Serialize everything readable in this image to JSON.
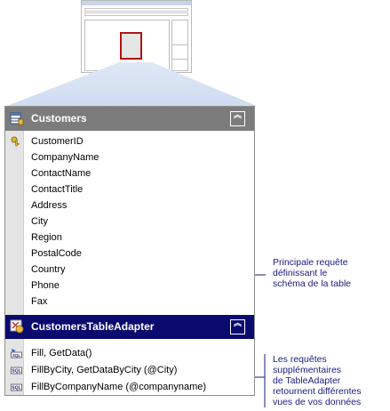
{
  "customers_table": {
    "title": "Customers",
    "columns": [
      {
        "name": "CustomerID",
        "key": true
      },
      {
        "name": "CompanyName"
      },
      {
        "name": "ContactName"
      },
      {
        "name": "ContactTitle"
      },
      {
        "name": "Address"
      },
      {
        "name": "City"
      },
      {
        "name": "Region"
      },
      {
        "name": "PostalCode"
      },
      {
        "name": "Country"
      },
      {
        "name": "Phone"
      },
      {
        "name": "Fax"
      }
    ]
  },
  "table_adapter": {
    "title": "CustomersTableAdapter",
    "queries": [
      {
        "label": "Fill, GetData()",
        "icon": "sql-main-query-icon"
      },
      {
        "label": "FillByCity, GetDataByCity (@City)",
        "icon": "sql-icon"
      },
      {
        "label": "FillByCompanyName (@companyname)",
        "icon": "sql-icon"
      }
    ]
  },
  "annotations": {
    "main_query": "Principale requête\ndéfinissant le\nschéma de la table",
    "additional_queries": "Les requêtes\nsupplémentaires\nde TableAdapter\nretournent différentes\nvues de vos données"
  },
  "collapse_glyph": "︽",
  "colors": {
    "customers_header": "#7c7c7c",
    "adapter_header": "#0b0b6f",
    "annotation_text": "#1a1a80",
    "thumbnail_object_border": "#b2120f"
  }
}
